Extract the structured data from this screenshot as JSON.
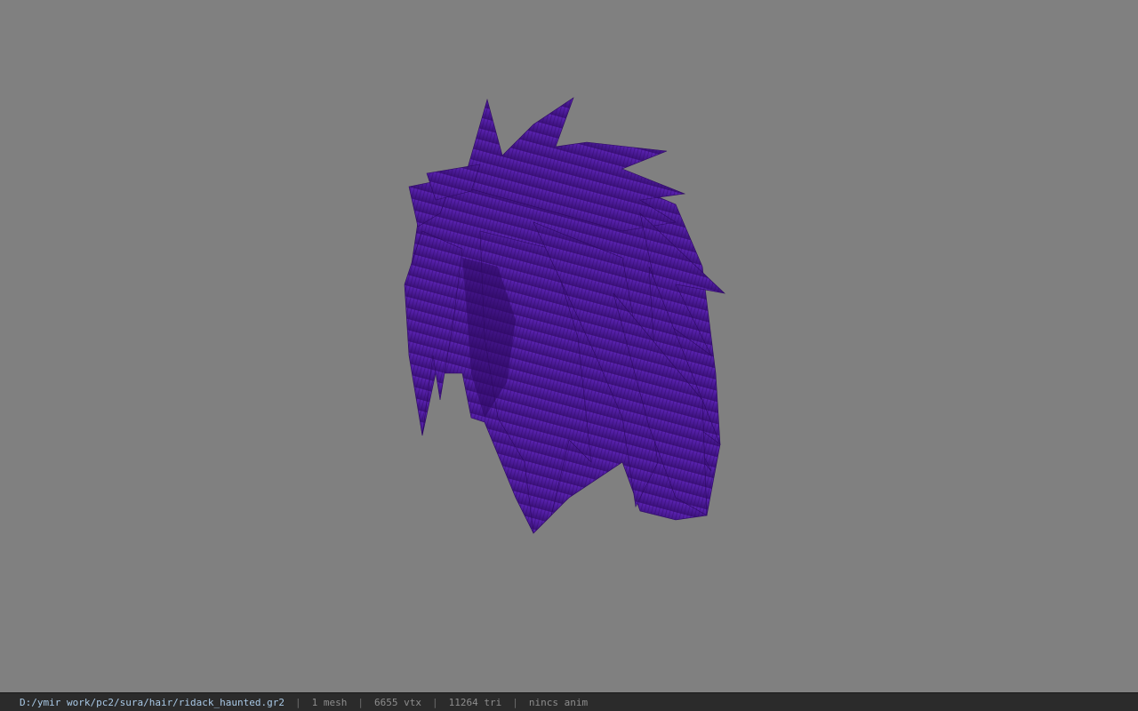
{
  "viewer": {
    "background_color": "#808080",
    "model_color": "#4a1a96",
    "model_icon": "hair-mesh-icon"
  },
  "status": {
    "file_path": "D:/ymir work/pc2/sura/hair/ridack_haunted.gr2",
    "sep1": "|",
    "mesh_count": "1 mesh",
    "sep2": "|",
    "vertex_count": "6655 vtx",
    "sep3": "|",
    "triangle_count": "11264 tri",
    "sep4": "|",
    "anim_status": "nincs anim"
  }
}
